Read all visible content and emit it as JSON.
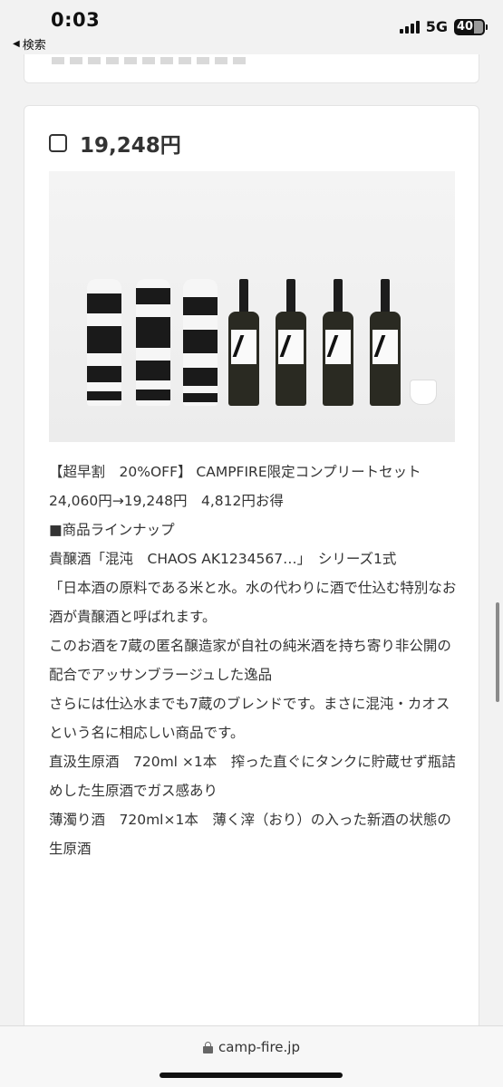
{
  "status_bar": {
    "time": "0:03",
    "back_label": "検索",
    "network": "5G",
    "battery": "40"
  },
  "card": {
    "price": "19,248円",
    "image_alt": "",
    "description": [
      "【超早割　20%OFF】 CAMPFIRE限定コンプリートセット",
      "24,060円→19,248円　4,812円お得",
      "",
      "■商品ラインナップ",
      "",
      "貴醸酒「混沌　CHAOS AK1234567…」　シリーズ1式",
      "",
      "「日本酒の原料である米と水。水の代わりに酒で仕込む特別なお酒が貴醸酒と呼ばれます。",
      "このお酒を7蔵の匿名醸造家が自社の純米酒を持ち寄り非公開の配合でアッサンブラージュした逸品",
      "さらには仕込水までも7蔵のブレンドです。まさに混沌・カオスという名に相応しい商品です。",
      "",
      "",
      "直汲生原酒　720ml ×1本　搾った直ぐにタンクに貯蔵せず瓶詰めした生原酒でガス感あり",
      "薄濁り酒　720ml×1本　薄く滓（おり）の入った新酒の状態の生原酒"
    ]
  },
  "address_bar": {
    "url": "camp-fire.jp"
  }
}
